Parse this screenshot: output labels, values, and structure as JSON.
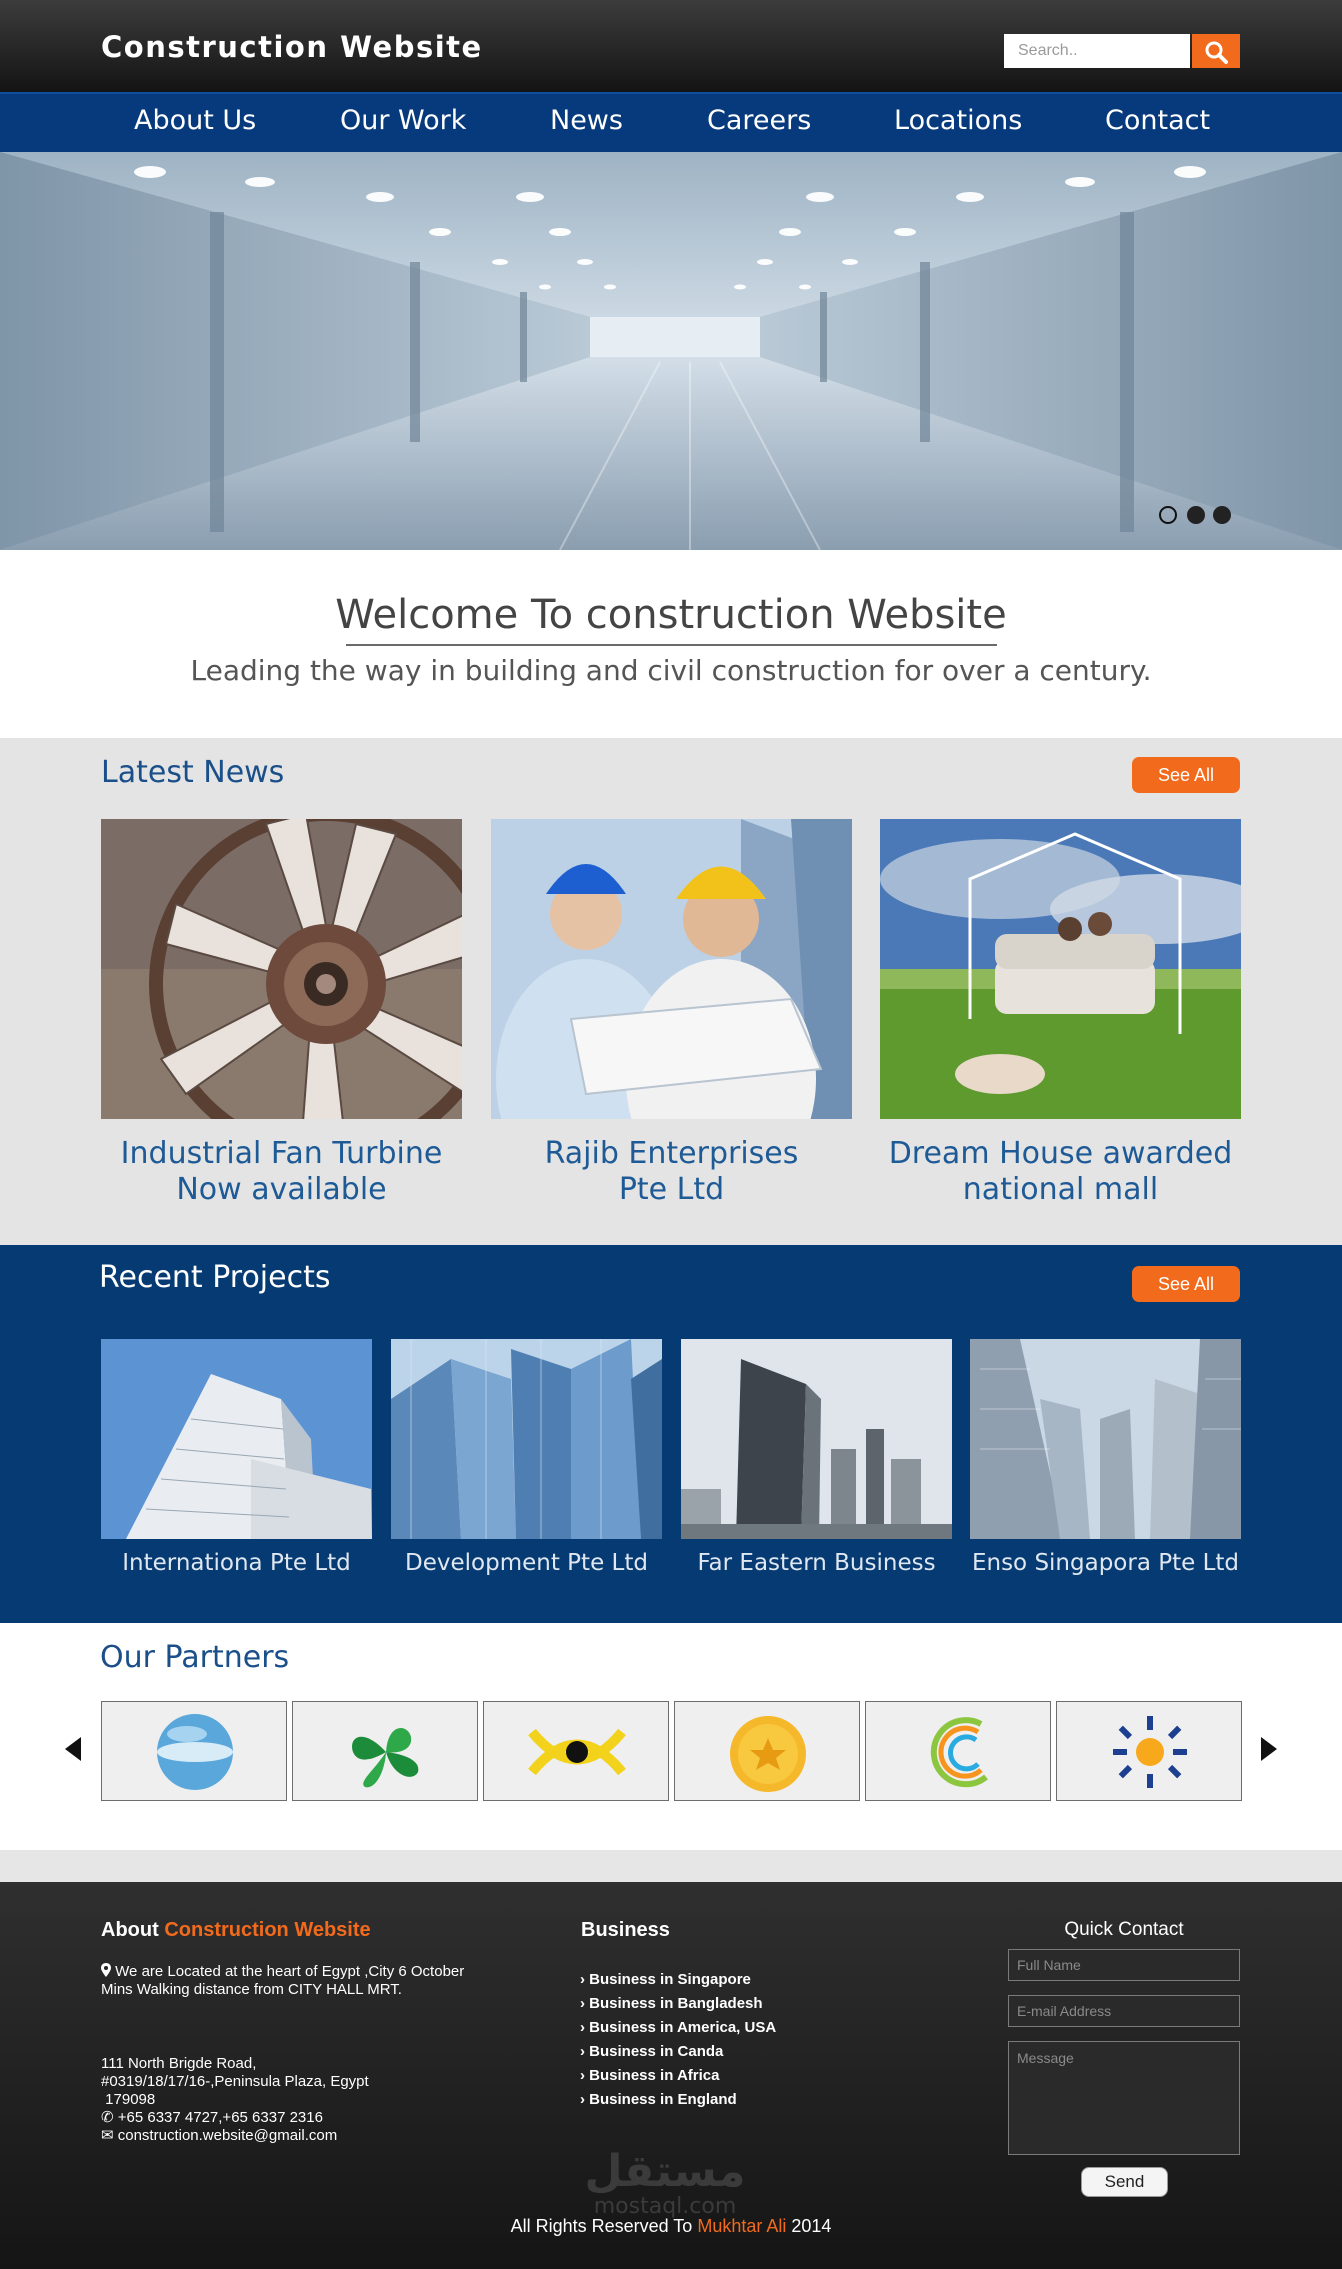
{
  "header": {
    "brand": "Construction Website",
    "search_placeholder": "Search.."
  },
  "nav": {
    "items": [
      "About Us",
      "Our Work",
      "News",
      "Careers",
      "Locations",
      "Contact"
    ]
  },
  "hero": {
    "slide_count": 3,
    "active_slide": 1
  },
  "welcome": {
    "title": "Welcome To construction Website",
    "subtitle": "Leading the way in building and civil construction for over a century."
  },
  "latest_news": {
    "title": "Latest News",
    "see_all": "See All",
    "items": [
      {
        "line1": "Industrial Fan Turbine",
        "line2": "Now available"
      },
      {
        "line1": "Rajib Enterprises",
        "line2": "Pte Ltd"
      },
      {
        "line1": "Dream House awarded",
        "line2": "national mall"
      }
    ]
  },
  "recent_projects": {
    "title": "Recent Projects",
    "see_all": "See All",
    "items": [
      "Internationa Pte Ltd",
      "Development Pte Ltd",
      "Far Eastern Business",
      "Enso Singapora Pte Ltd"
    ]
  },
  "partners": {
    "title": "Our Partners",
    "logos": [
      "sphere-logo",
      "leaf-logo",
      "eye-logo",
      "star-coin-logo",
      "swirl-logo",
      "sunburst-logo"
    ]
  },
  "footer": {
    "about_prefix": "About",
    "about_brand": "Construction Website",
    "location_text": "We are Located at the heart of Egypt ,City 6 October Mins Walking distance from CITY HALL MRT.",
    "address_line1": "111 North Brigde Road,",
    "address_line2": "#0319/18/17/16-,Peninsula Plaza, Egypt",
    "address_line3": " 179098",
    "phone": "+65 6337 4727,+65 6337 2316",
    "email": "construction.website@gmail.com",
    "business_title": "Business",
    "business_items": [
      "Business in Singapore",
      "Business in Bangladesh",
      "Business in America, USA",
      "Business in Canda",
      "Business in Africa",
      "Business in England"
    ],
    "quick_contact_title": "Quick Contact",
    "full_name_placeholder": "Full Name",
    "email_placeholder": "E-mail Address",
    "message_placeholder": "Message",
    "send_label": "Send",
    "watermark_arabic": "مستقل",
    "watermark_latin": "mostaql.com",
    "copyright_prefix": "All Rights Reserved To",
    "copyright_name": "Mukhtar Ali",
    "copyright_year": "2014"
  },
  "colors": {
    "accent": "#f26b1d",
    "nav_blue": "#063a7c",
    "projects_blue": "#063a72",
    "news_title": "#1e5a96"
  }
}
